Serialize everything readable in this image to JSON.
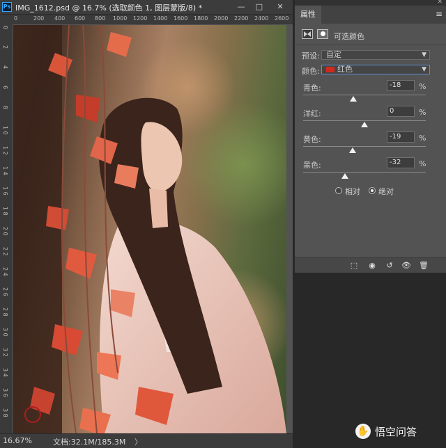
{
  "document": {
    "title": "IMG_1612.psd @ 16.7% (选取颜色 1, 图层蒙版/8) *",
    "logo_text": "Ps",
    "window_buttons": [
      "—",
      "□",
      "✕"
    ],
    "ruler_h": [
      "0",
      "200",
      "400",
      "600",
      "800",
      "1000",
      "1200",
      "1400",
      "1600",
      "1800",
      "2000",
      "2200",
      "2400",
      "2600"
    ],
    "ruler_v": [
      "0",
      "2",
      "4",
      "6",
      "8",
      "1 0",
      "1 2",
      "1 4",
      "1 6",
      "1 8",
      "2 0",
      "2 2",
      "2 4",
      "2 6",
      "2 8",
      "3 0",
      "3 2",
      "3 4",
      "3 6",
      "3 8"
    ],
    "status": {
      "zoom": "16.67%",
      "doc_size": "文档:32.1M/185.3M",
      "arrow": "〉"
    }
  },
  "properties": {
    "tab_label": "属性",
    "close_glyph": "✕",
    "menu_glyph": "≡",
    "adjustment_title": "可选颜色",
    "preset_label": "预设:",
    "preset_value": "自定",
    "color_label": "颜色:",
    "color_value": "红色",
    "swatch_color": "#d2281e",
    "sliders": [
      {
        "label": "青色:",
        "value": "-18",
        "unit": "%",
        "level": -18
      },
      {
        "label": "洋红:",
        "value": "0",
        "unit": "%",
        "level": 0
      },
      {
        "label": "黄色:",
        "value": "-19",
        "unit": "%",
        "level": -19
      },
      {
        "label": "黑色:",
        "value": "-32",
        "unit": "%",
        "level": -32
      }
    ],
    "method": {
      "relative": "相对",
      "absolute": "绝对",
      "selected": "absolute"
    },
    "footer_icons": [
      "clip-to-layer-icon",
      "view-previous-icon",
      "reset-icon",
      "visibility-eye-icon",
      "trash-icon"
    ],
    "footer_glyphs": [
      "⬚",
      "◉",
      "↺",
      "👁",
      "🗑"
    ]
  },
  "watermark": {
    "text": "悟空问答",
    "icon": "✋"
  }
}
